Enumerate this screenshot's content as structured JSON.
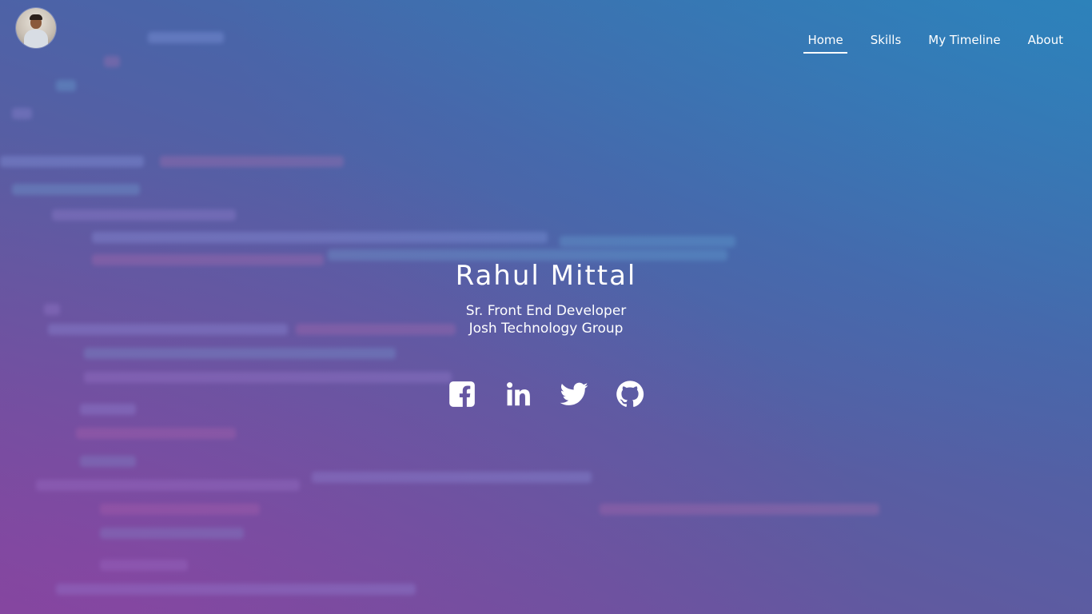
{
  "header": {
    "avatar_label": "profile-photo",
    "nav": [
      {
        "label": "Home",
        "active": true
      },
      {
        "label": "Skills",
        "active": false
      },
      {
        "label": "My Timeline",
        "active": false
      },
      {
        "label": "About",
        "active": false
      }
    ]
  },
  "hero": {
    "name": "Rahul Mittal",
    "role": "Sr. Front End Developer",
    "company": "Josh Technology Group"
  },
  "socials": [
    {
      "icon": "facebook-icon"
    },
    {
      "icon": "linkedin-icon"
    },
    {
      "icon": "twitter-icon"
    },
    {
      "icon": "github-icon"
    }
  ],
  "colors": {
    "text": "#ffffff",
    "bg_start": "#7a4a9c",
    "bg_end": "#2f7db4"
  }
}
